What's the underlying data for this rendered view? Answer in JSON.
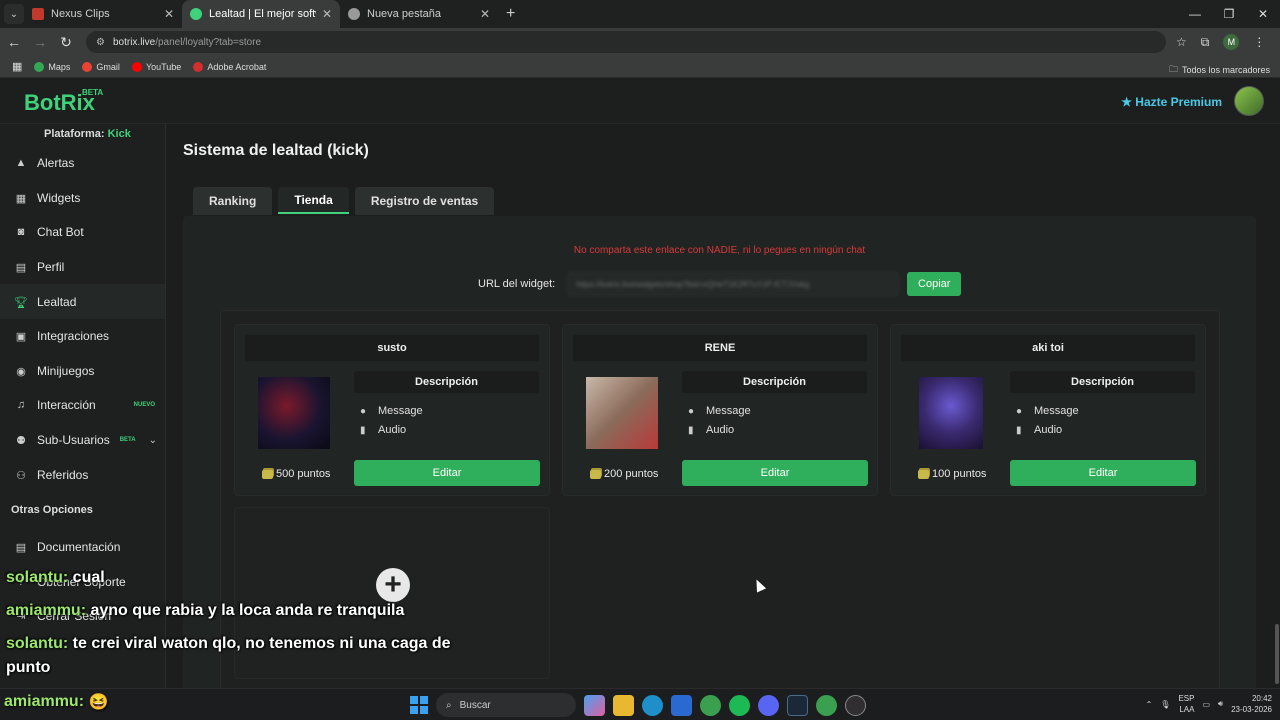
{
  "browser": {
    "tabs": [
      {
        "title": "Nexus Clips",
        "color": "#c0392b",
        "active": false
      },
      {
        "title": "Lealtad | El mejor software para",
        "color": "#3fd27a",
        "active": true
      },
      {
        "title": "Nueva pestaña",
        "color": "#999999",
        "active": false
      }
    ],
    "url_host": "botrix.live",
    "url_path": "/panel/loyalty?tab=store",
    "profile_initial": "M",
    "bookmarks": [
      {
        "label": "Maps",
        "color": "#34a853"
      },
      {
        "label": "Gmail",
        "color": "#ea4335"
      },
      {
        "label": "YouTube",
        "color": "#ff0000"
      },
      {
        "label": "Adobe Acrobat",
        "color": "#d32f2f"
      }
    ],
    "bookmarks_all": "Todos los marcadores"
  },
  "app": {
    "logo": "BotRix",
    "logo_badge": "BETA",
    "premium": "Hazte Premium",
    "platform_label": "Plataforma:",
    "platform_value": "Kick",
    "nav": [
      {
        "label": "Alertas",
        "icon": "warning-icon"
      },
      {
        "label": "Widgets",
        "icon": "widgets-icon"
      },
      {
        "label": "Chat Bot",
        "icon": "robot-icon"
      },
      {
        "label": "Perfil",
        "icon": "profile-icon"
      },
      {
        "label": "Lealtad",
        "icon": "trophy-icon"
      },
      {
        "label": "Integraciones",
        "icon": "integration-icon"
      },
      {
        "label": "Minijuegos",
        "icon": "gamepad-icon"
      },
      {
        "label": "Interacción",
        "icon": "music-icon",
        "badge": "NUEVO"
      },
      {
        "label": "Sub-Usuarios",
        "icon": "users-icon",
        "badge": "BETA"
      },
      {
        "label": "Referidos",
        "icon": "referral-icon"
      }
    ],
    "other_options_title": "Otras Opciones",
    "other_nav": [
      {
        "label": "Documentación"
      },
      {
        "label": "Obtener Soporte"
      },
      {
        "label": "Cerrar Sesión"
      }
    ]
  },
  "page": {
    "title": "Sistema de lealtad (kick)",
    "tabs": [
      "Ranking",
      "Tienda",
      "Registro de ventas"
    ],
    "active_tab": "Tienda",
    "warning": "No comparta este enlace con NADIE, ni lo pegues en ningún chat",
    "widget_url_label": "URL del widget:",
    "widget_url_value": "https://botrix.live/widgets/shop?bid=xQHeT1K2R7uYzP-fCTJVskg",
    "copy_button": "Copiar",
    "description_label": "Descripción",
    "edit_label": "Editar",
    "items": [
      {
        "name": "susto",
        "features": [
          "Message",
          "Audio"
        ],
        "price": "500 puntos"
      },
      {
        "name": "RENE",
        "features": [
          "Message",
          "Audio"
        ],
        "price": "200 puntos"
      },
      {
        "name": "aki toi",
        "features": [
          "Message",
          "Audio"
        ],
        "price": "100 puntos"
      }
    ]
  },
  "chat_overlay": [
    {
      "user": "solantu:",
      "text": "cual"
    },
    {
      "user": "amiammu:",
      "text": "ayno que rabia y la loca anda re tranquila"
    },
    {
      "user": "solantu:",
      "text": "te crei viral waton qlo, no tenemos ni una caga de"
    },
    {
      "user": "",
      "text": "punto"
    },
    {
      "user": "amiammu:",
      "text": "😆"
    }
  ],
  "taskbar": {
    "search": "Buscar",
    "lang_top": "ESP",
    "lang_bottom": "LAA",
    "time": "20:42",
    "date": "23-03-2026"
  }
}
